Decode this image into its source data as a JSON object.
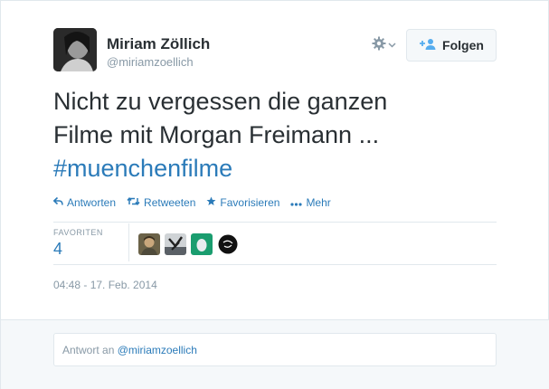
{
  "author": {
    "fullname": "Miriam Zöllich",
    "username": "@miriamzoellich"
  },
  "header": {
    "follow_label": "Folgen",
    "gear_icon": "gear-icon",
    "follow_icon": "follow-user-icon"
  },
  "tweet": {
    "text_line1": "Nicht zu vergessen die ganzen",
    "text_line2": "Filme mit Morgan Freimann ...",
    "hashtag": "#muenchenfilme"
  },
  "actions": {
    "reply": "Antworten",
    "retweet": "Retweeten",
    "favorite": "Favorisieren",
    "more": "Mehr"
  },
  "stats": {
    "favorites_label": "FAVORITEN",
    "favorites_count": "4",
    "fav_avatars": [
      "favoriter-avatar-1",
      "favoriter-avatar-2",
      "favoriter-avatar-3",
      "favoriter-avatar-4"
    ]
  },
  "timestamp": "04:48 - 17. Feb. 2014",
  "reply": {
    "prefix": "Antwort an ",
    "mention": "@miriamzoellich"
  },
  "colors": {
    "link": "#2b7bb9",
    "muted": "#8899a6",
    "text": "#292f33",
    "background": "#f5f8fa"
  }
}
